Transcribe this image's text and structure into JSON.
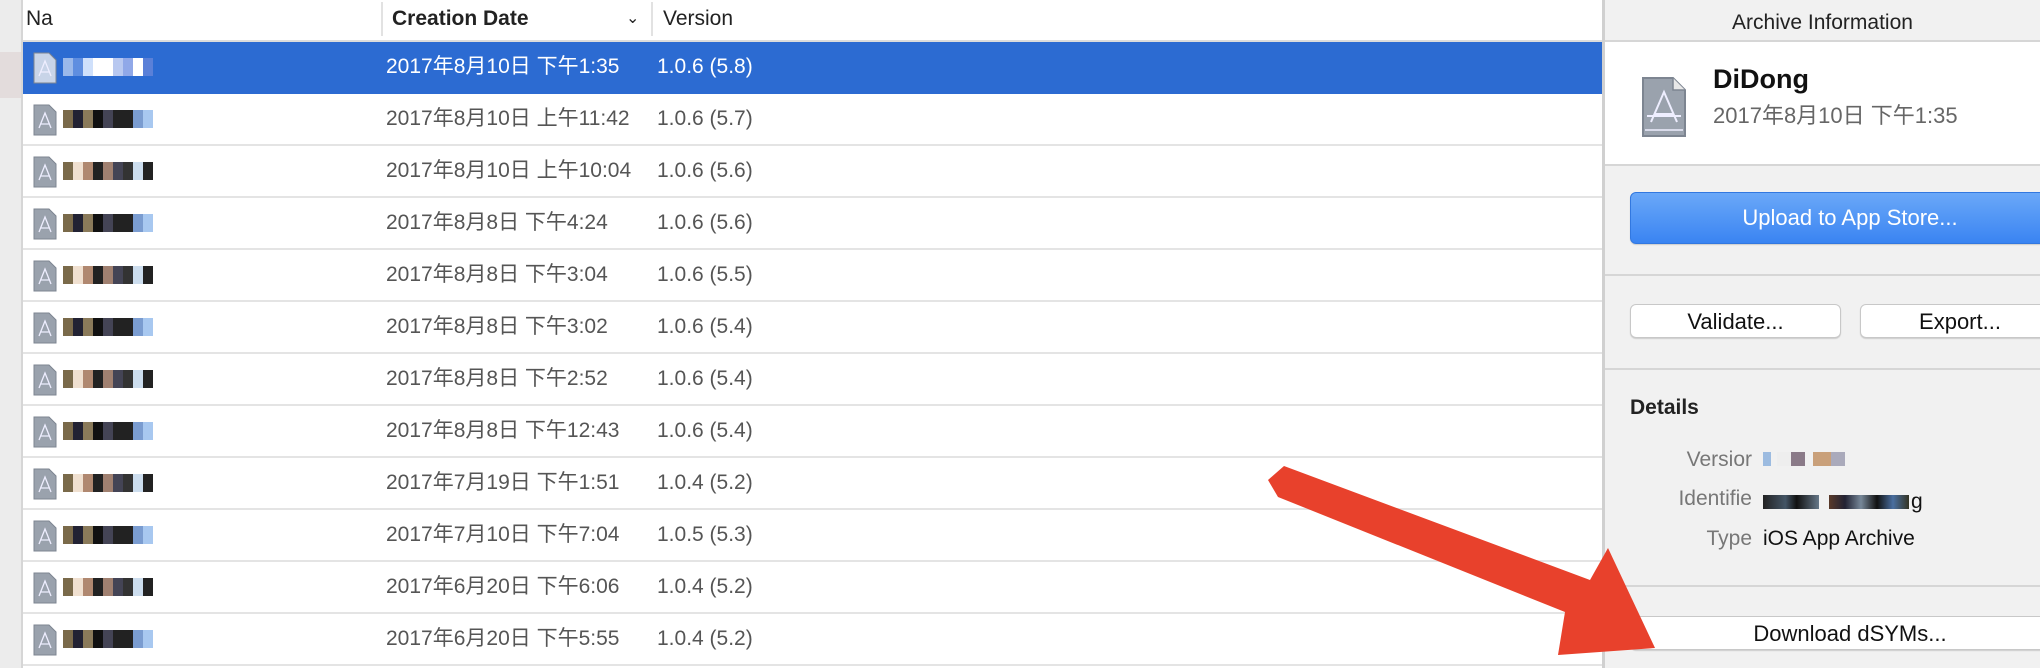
{
  "table": {
    "columns": [
      {
        "label": "Na"
      },
      {
        "label": "Creation Date"
      },
      {
        "label": "Version"
      }
    ],
    "sort_icon": "chevron-down-icon",
    "selected_row": 0,
    "rows": [
      {
        "date": "2017年8月10日 下午1:35",
        "version": "1.0.6 (5.8)"
      },
      {
        "date": "2017年8月10日 上午11:42",
        "version": "1.0.6 (5.7)"
      },
      {
        "date": "2017年8月10日 上午10:04",
        "version": "1.0.6 (5.6)"
      },
      {
        "date": "2017年8月8日 下午4:24",
        "version": "1.0.6 (5.6)"
      },
      {
        "date": "2017年8月8日 下午3:04",
        "version": "1.0.6 (5.5)"
      },
      {
        "date": "2017年8月8日 下午3:02",
        "version": "1.0.6 (5.4)"
      },
      {
        "date": "2017年8月8日 下午2:52",
        "version": "1.0.6 (5.4)"
      },
      {
        "date": "2017年8月8日 下午12:43",
        "version": "1.0.6 (5.4)"
      },
      {
        "date": "2017年7月19日 下午1:51",
        "version": "1.0.4 (5.2)"
      },
      {
        "date": "2017年7月10日 下午7:04",
        "version": "1.0.5 (5.3)"
      },
      {
        "date": "2017年6月20日 下午6:06",
        "version": "1.0.4 (5.2)"
      },
      {
        "date": "2017年6月20日 下午5:55",
        "version": "1.0.4 (5.2)"
      }
    ]
  },
  "panel": {
    "header": "Archive Information",
    "archive_name": "DiDong",
    "archive_date": "2017年8月10日 下午1:35",
    "upload_label": "Upload to App Store...",
    "validate_label": "Validate...",
    "export_label": "Export...",
    "details_title": "Details",
    "version_label": "Versior",
    "identifier_label": "Identifie",
    "identifier_value_suffix": "g",
    "type_label": "Type",
    "type_value": "iOS App Archive",
    "download_label": "Download dSYMs..."
  },
  "colors": {
    "selection": "#2c6bd2",
    "primary_button": "#3a84f2",
    "annotation_arrow": "#e8412c"
  }
}
